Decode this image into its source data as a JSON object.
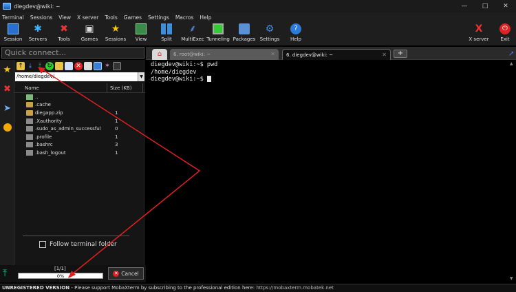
{
  "window": {
    "title": "diegdev@wiki: ~"
  },
  "menu": [
    "Terminal",
    "Sessions",
    "View",
    "X server",
    "Tools",
    "Games",
    "Settings",
    "Macros",
    "Help"
  ],
  "toolbar": {
    "session": "Session",
    "servers": "Servers",
    "tools": "Tools",
    "games": "Games",
    "sessions": "Sessions",
    "view": "View",
    "split": "Split",
    "multiexec": "MultiExec",
    "tunneling": "Tunneling",
    "packages": "Packages",
    "settings": "Settings",
    "help": "Help",
    "xserver": "X server",
    "exit": "Exit"
  },
  "quick_connect": {
    "placeholder": "Quick connect..."
  },
  "sftp": {
    "path": "/home/diegdev/",
    "columns": {
      "name": "Name",
      "size": "Size (KB)"
    },
    "files": [
      {
        "name": "..",
        "size": "",
        "kind": "up"
      },
      {
        "name": ".cache",
        "size": "",
        "kind": "folder"
      },
      {
        "name": "diegapp.zip",
        "size": "1",
        "kind": "folder"
      },
      {
        "name": ".Xauthority",
        "size": "1",
        "kind": "file"
      },
      {
        "name": ".sudo_as_admin_successful",
        "size": "0",
        "kind": "file"
      },
      {
        "name": ".profile",
        "size": "1",
        "kind": "file"
      },
      {
        "name": ".bashrc",
        "size": "3",
        "kind": "file"
      },
      {
        "name": ".bash_logout",
        "size": "1",
        "kind": "file"
      }
    ],
    "follow_label": "Follow terminal folder"
  },
  "transfer": {
    "count": "[1/1]",
    "percent_label": "0%",
    "progress": 0,
    "cancel_label": "Cancel"
  },
  "tabs": [
    {
      "label": "6. root@wiki: ~",
      "active": false
    },
    {
      "label": "6. diegdev@wiki: ~",
      "active": true
    }
  ],
  "terminal": {
    "lines": [
      "diegdev@wiki:~$ pwd",
      "/home/diegdev",
      "diegdev@wiki:~$ "
    ]
  },
  "status": {
    "registration": "UNREGISTERED VERSION",
    "message": " -  Please support MobaXterm by subscribing to the professional edition here: ",
    "url": "https://mobaxterm.mobatek.net"
  },
  "colors": {
    "annotation": "#e0201f",
    "accent": "#2b7bd8",
    "upload": "#00c090"
  }
}
